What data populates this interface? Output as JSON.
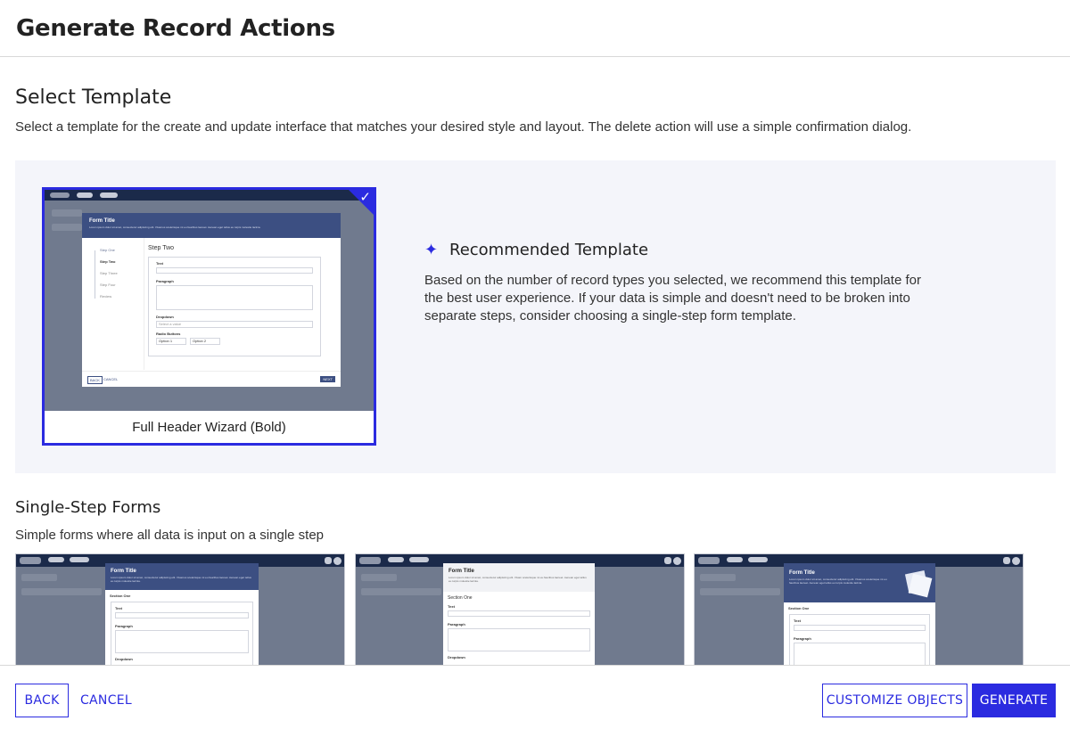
{
  "header": {
    "title": "Generate Record Actions"
  },
  "select_template": {
    "title": "Select Template",
    "description": "Select a template for the create and update interface that matches your desired style and layout. The delete action will use a simple confirmation dialog."
  },
  "recommended": {
    "card_label": "Full Header Wizard (Bold)",
    "title": "Recommended Template",
    "description": "Based on the number of record types you selected, we recommend this template for the best user experience. If your data is simple and doesn't need to be broken into separate steps, consider choosing a single-step form template.",
    "icon": "sparkle-icon",
    "accent": "#2b2be0",
    "preview": {
      "form_title": "Form Title",
      "form_sub": "Lorem ipsum dolor sit amet, consectetur adipiscing elit. Vivamus scelerisque mi eu faucibus laoreet. Aenean eget tellus eu turpis molestie lacinia.",
      "steps": [
        "Step One",
        "Step Two",
        "Step Three",
        "Step Four",
        "Review"
      ],
      "step_heading": "Step Two",
      "field_text": "Text",
      "field_paragraph": "Paragraph",
      "field_dropdown": "Dropdown",
      "dropdown_placeholder": "Select a value",
      "field_radio": "Radio Buttons",
      "option1": "Option 1",
      "option2": "Option 2",
      "back": "BACK",
      "cancel": "CANCEL",
      "next": "NEXT"
    }
  },
  "single_step": {
    "title": "Single-Step Forms",
    "description": "Simple forms where all data is input on a single step",
    "cards": [
      {
        "form_title": "Form Title",
        "form_sub": "Lorem ipsum dolor sit amet, consectetur adipiscing elit. Vivamus scelerisque mi eu faucibus laoreet. Aenean eget tellus eu turpis molestie lacinia.",
        "section": "Section One",
        "f1": "Text",
        "f2": "Paragraph",
        "f3": "Dropdown"
      },
      {
        "form_title": "Form Title",
        "form_sub": "Lorem ipsum dolor sit amet, consectetur adipiscing elit. Vivam scelerisque mi eu faucibus laoreet. Aenean eget tellus eu turpis molestie lacinia.",
        "section": "Section One",
        "f1": "Text",
        "f2": "Paragraph",
        "f3": "Dropdown"
      },
      {
        "form_title": "Form Title",
        "form_sub": "Lorem ipsum dolor sit amet, consectetur adipiscing elit. Vivamus scelerisque mi eu faucibus laoreet. Aenean eget tellus eu turpis molestie lacinia.",
        "section": "Section One",
        "f1": "Text",
        "f2": "Paragraph"
      }
    ]
  },
  "footer": {
    "back": "BACK",
    "cancel": "CANCEL",
    "customize": "CUSTOMIZE OBJECTS",
    "generate": "GENERATE"
  }
}
